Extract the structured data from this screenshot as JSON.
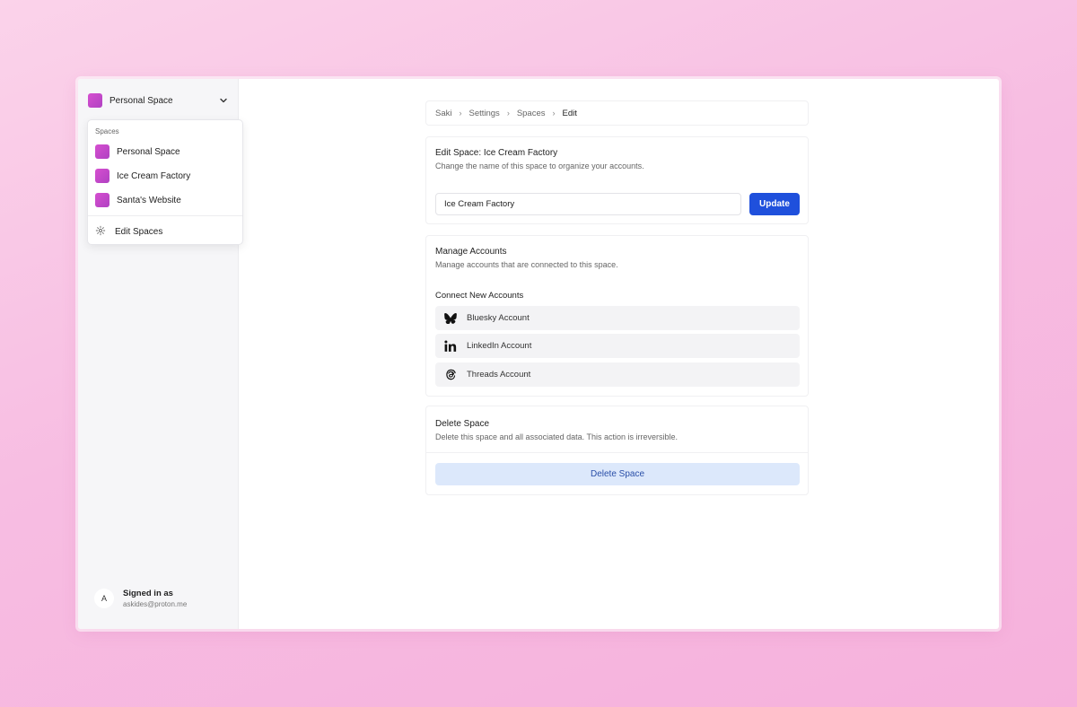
{
  "sidebar": {
    "current_space": "Personal Space",
    "dropdown": {
      "section_label": "Spaces",
      "items": [
        {
          "label": "Personal Space"
        },
        {
          "label": "Ice Cream Factory"
        },
        {
          "label": "Santa's Website"
        }
      ],
      "edit_label": "Edit Spaces"
    },
    "user": {
      "avatar_initial": "A",
      "signed_in_label": "Signed in as",
      "email": "askides@proton.me"
    }
  },
  "breadcrumb": [
    "Saki",
    "Settings",
    "Spaces",
    "Edit"
  ],
  "edit_space": {
    "title": "Edit Space: Ice Cream Factory",
    "subtitle": "Change the name of this space to organize your accounts.",
    "name_value": "Ice Cream Factory",
    "update_label": "Update"
  },
  "manage_accounts": {
    "title": "Manage Accounts",
    "subtitle": "Manage accounts that are connected to this space.",
    "connect_label": "Connect New Accounts",
    "accounts": [
      {
        "label": "Bluesky Account",
        "icon": "butterfly-icon"
      },
      {
        "label": "LinkedIn Account",
        "icon": "linkedin-icon"
      },
      {
        "label": "Threads Account",
        "icon": "threads-icon"
      }
    ]
  },
  "delete_space": {
    "title": "Delete Space",
    "subtitle": "Delete this space and all associated data. This action is irreversible.",
    "button_label": "Delete Space"
  },
  "colors": {
    "accent": "#1f50dc",
    "space_swatch": "#c948cb",
    "delete_bg": "#dce8fb"
  }
}
